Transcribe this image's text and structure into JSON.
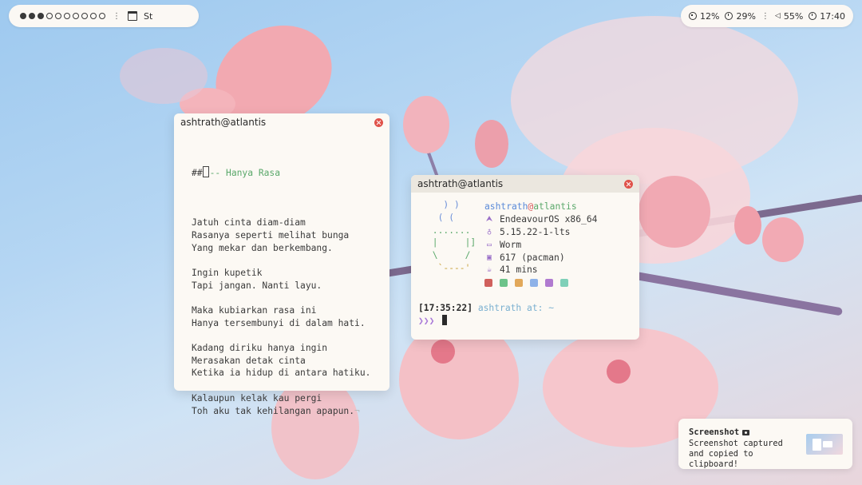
{
  "topbar": {
    "workspaces": [
      {
        "label": "workspace-1",
        "active": true
      },
      {
        "label": "workspace-2",
        "active": true
      },
      {
        "label": "workspace-3",
        "active": true
      },
      {
        "label": "workspace-4",
        "active": false
      },
      {
        "label": "workspace-5",
        "active": false
      },
      {
        "label": "workspace-6",
        "active": false
      },
      {
        "label": "workspace-7",
        "active": false
      },
      {
        "label": "workspace-8",
        "active": false
      },
      {
        "label": "workspace-9",
        "active": false
      },
      {
        "label": "workspace-10",
        "active": false
      }
    ],
    "separator": "⋮",
    "active_window": "St",
    "cpu": "12%",
    "memory": "29%",
    "volume": "55%",
    "clock": "17:40",
    "icons": {
      "cpu": "cpu-icon",
      "memory": "pie-icon",
      "volume": "speaker-icon",
      "clock": "clock-icon",
      "window": "window-icon"
    }
  },
  "editor_window": {
    "title": "ashtrath@atlantis",
    "heading_prefix": "##",
    "heading_text": "-- Hanya Rasa",
    "lines": [
      "",
      "Jatuh cinta diam-diam",
      "Rasanya seperti melihat bunga",
      "Yang mekar dan berkembang.",
      "",
      "Ingin kupetik",
      "Tapi jangan. Nanti layu.",
      "",
      "Maka kubiarkan rasa ini",
      "Hanya tersembunyi di dalam hati.",
      "",
      "Kadang diriku hanya ingin",
      "Merasakan detak cinta",
      "Ketika ia hidup di antara hatiku.",
      "",
      "Kalaupun kelak kau pergi",
      "Toh aku tak kehilangan apapun."
    ],
    "eol_marker": "¬"
  },
  "terminal_window": {
    "title": "ashtrath@atlantis",
    "art": [
      "   ) )",
      "  ( (",
      " .......",
      " |     |]",
      " \\     /",
      "  `----'"
    ],
    "user": "ashtrath",
    "at": "@",
    "host": "atlantis",
    "info": [
      {
        "icon": "arch-icon",
        "glyph": "⮝",
        "value": "EndeavourOS x86_64"
      },
      {
        "icon": "penguin-icon",
        "glyph": "♁",
        "value": "5.15.22-1-lts"
      },
      {
        "icon": "window-icon",
        "glyph": "▭",
        "value": "Worm"
      },
      {
        "icon": "package-icon",
        "glyph": "▣",
        "value": "617 (pacman)"
      },
      {
        "icon": "cup-icon",
        "glyph": "☕",
        "value": "41 mins"
      }
    ],
    "swatches": [
      "#d0605c",
      "#6cc38a",
      "#e2a85a",
      "#8eb2e8",
      "#b07ad0",
      "#7fd0b8"
    ],
    "prompt_time": "[17:35:22]",
    "prompt_path": "ashtrath at: ~",
    "prompt_symbol": "❯❯❯"
  },
  "notification": {
    "title": "Screenshot",
    "body": "Screenshot captured and copied to clipboard!",
    "icon": "camera-icon"
  }
}
